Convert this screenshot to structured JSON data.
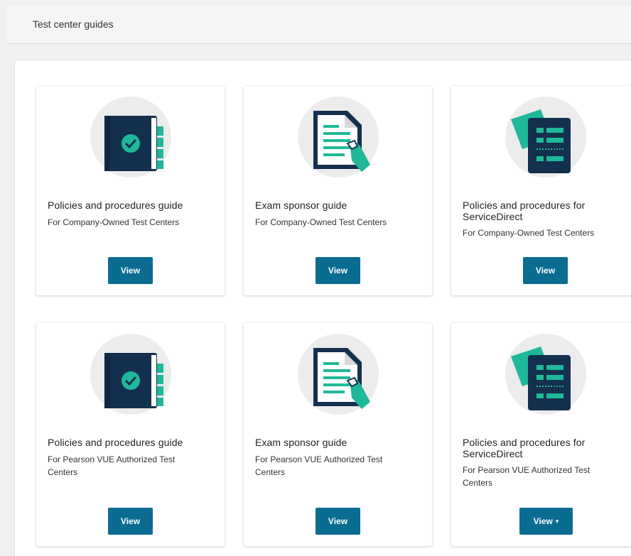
{
  "header": {
    "title": "Test center guides"
  },
  "cards": [
    {
      "title": "Policies and procedures guide",
      "subtitle": "For Company-Owned Test Centers",
      "button": "View",
      "icon": "guide-book-icon"
    },
    {
      "title": "Exam sponsor guide",
      "subtitle": "For Company-Owned Test Centers",
      "button": "View",
      "icon": "document-hand-icon"
    },
    {
      "title": "Policies and procedures for ServiceDirect",
      "subtitle": "For Company-Owned Test Centers",
      "button": "View",
      "icon": "list-tablet-icon"
    },
    {
      "title": "Policies and procedures guide",
      "subtitle": "For Pearson VUE Authorized Test Centers",
      "button": "View",
      "icon": "guide-book-icon"
    },
    {
      "title": "Exam sponsor guide",
      "subtitle": "For Pearson VUE Authorized Test Centers",
      "button": "View",
      "icon": "document-hand-icon"
    },
    {
      "title": "Policies and procedures for ServiceDirect",
      "subtitle": "For Pearson VUE Authorized Test Centers",
      "button": "View",
      "button_caret": "▾",
      "icon": "list-tablet-icon"
    }
  ],
  "colors": {
    "button": "#0b6c91",
    "navy": "#14304f",
    "teal": "#1fb89a",
    "circle": "#ececec"
  }
}
